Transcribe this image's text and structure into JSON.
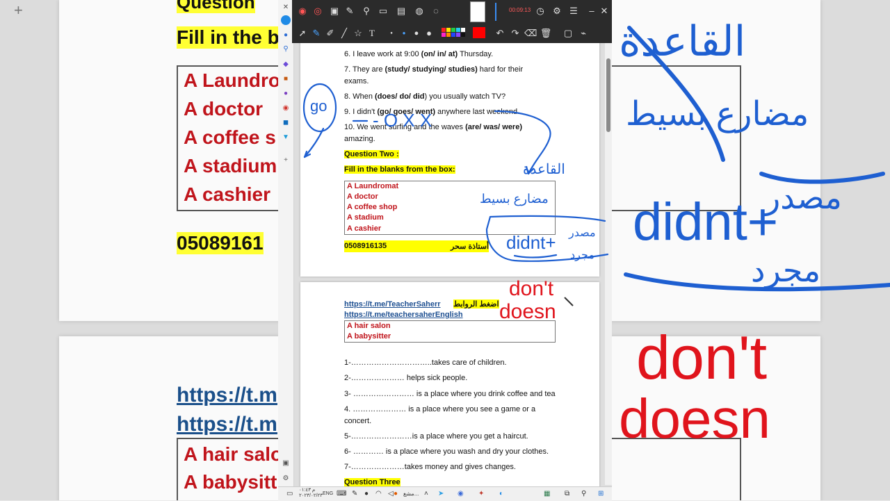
{
  "background": {
    "question_fragment": "Question",
    "fill_fragment": "Fill in the b",
    "box1_items": [
      "A Laundro",
      "A doctor",
      "A coffee s",
      "A stadium",
      "A cashier"
    ],
    "phone_fragment": "05089161",
    "link1_fragment": "https://t.m",
    "link2_fragment": "https://t.m",
    "box2_items": [
      "A hair salo",
      "A babysitt"
    ],
    "ink_didnt": "didnt+",
    "ink_dont": "don't",
    "ink_doesn": "doesn",
    "ink_arabic_1": "القاعدة",
    "ink_arabic_2": "مضارع بسيط",
    "ink_arabic_3": "مصدر",
    "ink_arabic_4": "مجرد"
  },
  "toolbar": {
    "record_time": "00:09:13"
  },
  "page1": {
    "q6_pre": "6. I leave work at 9:00 ",
    "q6_opts": "(on/ in/ at)",
    "q6_post": " Thursday.",
    "q7_pre": "7. They are ",
    "q7_opts": "(study/ studying/ studies)",
    "q7_post": " hard for their",
    "q7_cont": "exams.",
    "q8_pre": "8. When ",
    "q8_opts": "(does/ do/ did",
    "q8_post": ") you usually watch TV?",
    "q9_pre": "9. I didn't ",
    "q9_opts": "(go/ goes/ went)",
    "q9_post": " anywhere last weekend.",
    "q10_pre": "10. We went surfing and the waves ",
    "q10_opts": "(are/ was/ were)",
    "q10_cont": "amazing.",
    "question_two": "Question Two :",
    "fill_blanks": "Fill in the blanks from the box:",
    "box_items": [
      "A Laundromat",
      "A doctor",
      "A coffee shop",
      "A stadium",
      "A cashier"
    ],
    "phone": "0508916135",
    "teacher": "أستاذة سحر"
  },
  "page2": {
    "link1": "https://t.me/TeacherSaherr",
    "links_label": "اضغط الروابط",
    "link2": "https://t.me/teachersaherEnglish",
    "box_items": [
      "A hair salon",
      "A babysitter"
    ],
    "items": [
      "1-…………………………..takes care of children.",
      "2-………………… helps sick people.",
      "3- …………………… is a place where you drink coffee and tea",
      "4. ………………… is a place where you see a game or a",
      "concert.",
      "5-……………………is a place where you get a haircut.",
      "6- ………… is a place where you wash and dry your clothes.",
      "7-…………………takes money and gives changes."
    ],
    "question_three": "Question Three"
  },
  "annotations": {
    "go": "go",
    "marks": "- O X X",
    "arabic_rule": "القاعدة",
    "arabic_tense": "مضارع بسيط",
    "didnt": "didnt+",
    "masdar": "مصدر",
    "mujarrad": "مجرد",
    "dont": "don't",
    "doesn": "doesn"
  },
  "taskbar": {
    "lang": "ENG",
    "clock_line1": "م ٠١:٤٣",
    "clock_line2": "٢٠٢٣/٠٢/٢٣",
    "app_label": "مشغ..."
  },
  "colors": {
    "ink_blue": "#1e5fd1",
    "ink_red": "#e0141c",
    "highlight": "#ffff00",
    "answer_red": "#c0141b",
    "toolbar_bg": "#2b2b2b"
  }
}
